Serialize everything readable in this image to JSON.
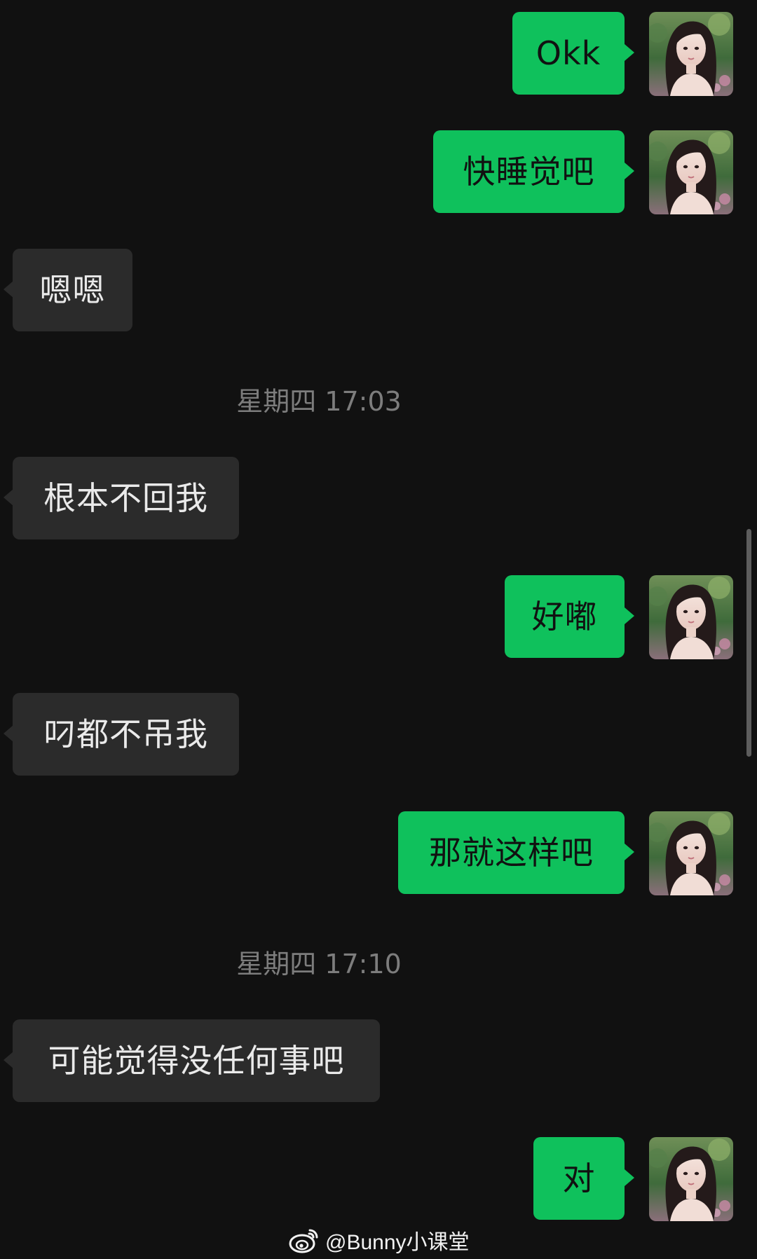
{
  "colors": {
    "background": "#111111",
    "my_bubble": "#0fc15c",
    "their_bubble": "#2b2b2b",
    "timestamp_text": "#7d7d7d"
  },
  "messages": [
    {
      "sender": "me",
      "text": "Okk",
      "avatar": "avatar-woman-long-hair"
    },
    {
      "sender": "me",
      "text": "快睡觉吧",
      "avatar": "avatar-woman-long-hair"
    },
    {
      "sender": "them",
      "text": "嗯嗯"
    },
    {
      "timestamp": "星期四 17:03"
    },
    {
      "sender": "them",
      "text": "根本不回我"
    },
    {
      "sender": "me",
      "text": "好嘟",
      "avatar": "avatar-woman-long-hair"
    },
    {
      "sender": "them",
      "text": "叼都不吊我"
    },
    {
      "sender": "me",
      "text": "那就这样吧",
      "avatar": "avatar-woman-long-hair"
    },
    {
      "timestamp": "星期四 17:10"
    },
    {
      "sender": "them",
      "text": "可能觉得没任何事吧"
    },
    {
      "sender": "me",
      "text": "对",
      "avatar": "avatar-woman-long-hair"
    }
  ],
  "watermark": {
    "icon": "weibo-icon",
    "text": "@Bunny小课堂"
  }
}
